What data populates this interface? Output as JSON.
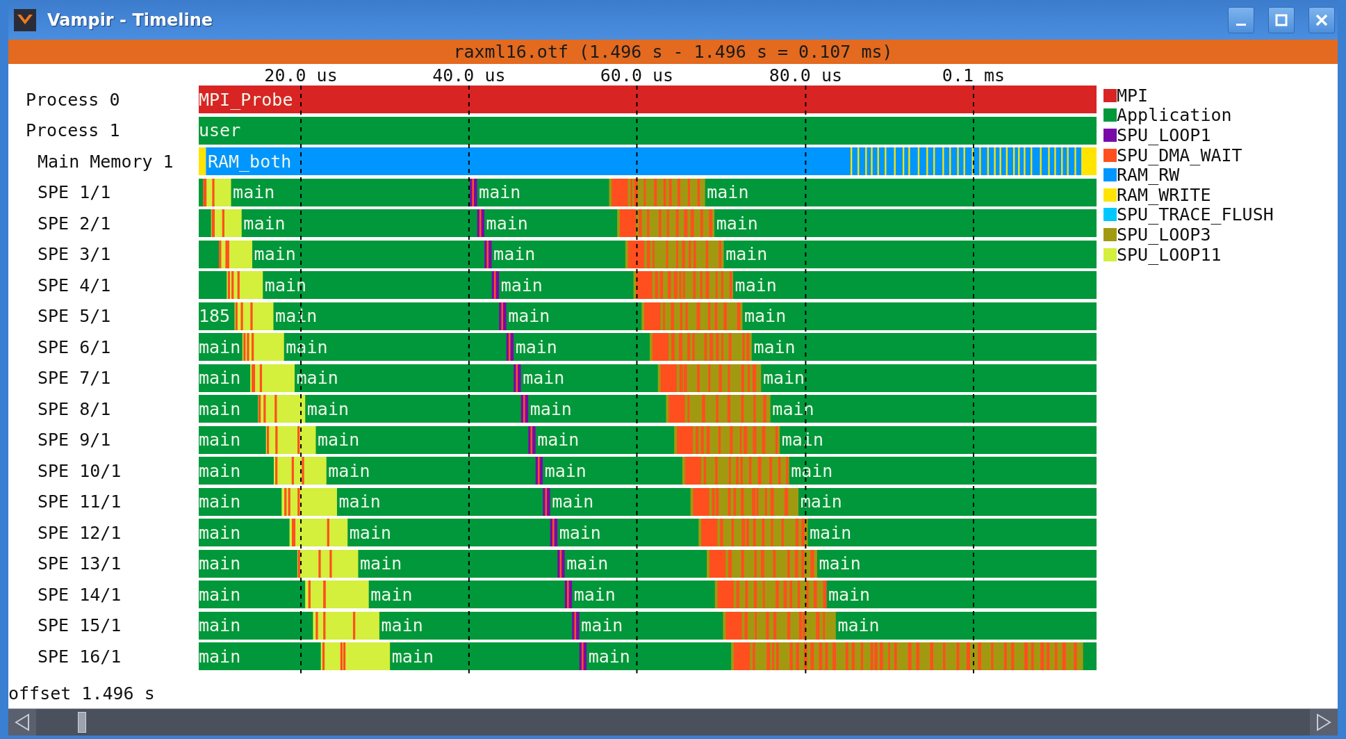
{
  "window": {
    "title": "Vampir - Timeline"
  },
  "header": "raxml16.otf (1.496 s - 1.496 s = 0.107 ms)",
  "axis": {
    "ticks": [
      "20.0 us",
      "40.0 us",
      "60.0 us",
      "80.0 us",
      "0.1 ms"
    ]
  },
  "rows": [
    {
      "label": "Process 0",
      "kind": "mpi",
      "segment_labels": [
        "MPI_Probe"
      ]
    },
    {
      "label": "Process 1",
      "kind": "application",
      "segment_labels": [
        "user"
      ]
    },
    {
      "label": "Main Memory 1",
      "kind": "memory",
      "segment_labels": [
        "RAM_both"
      ]
    },
    {
      "label": "SPE 1/1",
      "kind": "spe",
      "open_end": false,
      "segment_labels": [
        "main",
        "main",
        "main"
      ]
    },
    {
      "label": "SPE 2/1",
      "kind": "spe",
      "open_end": false,
      "segment_labels": [
        "main",
        "main",
        "main"
      ]
    },
    {
      "label": "SPE 3/1",
      "kind": "spe",
      "open_end": false,
      "segment_labels": [
        "main",
        "main",
        "main"
      ]
    },
    {
      "label": "SPE 4/1",
      "kind": "spe",
      "open_end": false,
      "segment_labels": [
        "main",
        "main",
        "main"
      ]
    },
    {
      "label": "SPE 5/1",
      "kind": "spe",
      "open_end": false,
      "segment_labels": [
        "185",
        "main",
        "main",
        "main"
      ]
    },
    {
      "label": "SPE 6/1",
      "kind": "spe",
      "open_end": false,
      "segment_labels": [
        "main",
        "main",
        "main",
        "main"
      ]
    },
    {
      "label": "SPE 7/1",
      "kind": "spe",
      "open_end": false,
      "segment_labels": [
        "main",
        "main",
        "main",
        "main"
      ]
    },
    {
      "label": "SPE 8/1",
      "kind": "spe",
      "open_end": false,
      "segment_labels": [
        "main",
        "main",
        "main",
        "main"
      ]
    },
    {
      "label": "SPE 9/1",
      "kind": "spe",
      "open_end": false,
      "segment_labels": [
        "main",
        "main",
        "main",
        "main"
      ]
    },
    {
      "label": "SPE 10/1",
      "kind": "spe",
      "open_end": false,
      "segment_labels": [
        "main",
        "main",
        "main",
        "main"
      ]
    },
    {
      "label": "SPE 11/1",
      "kind": "spe",
      "open_end": false,
      "segment_labels": [
        "main",
        "main",
        "main",
        "main"
      ]
    },
    {
      "label": "SPE 12/1",
      "kind": "spe",
      "open_end": false,
      "segment_labels": [
        "main",
        "main",
        "main",
        "main"
      ]
    },
    {
      "label": "SPE 13/1",
      "kind": "spe",
      "open_end": false,
      "segment_labels": [
        "main",
        "main",
        "main",
        "main"
      ]
    },
    {
      "label": "SPE 14/1",
      "kind": "spe",
      "open_end": false,
      "segment_labels": [
        "main",
        "main",
        "main",
        "main"
      ]
    },
    {
      "label": "SPE 15/1",
      "kind": "spe",
      "open_end": false,
      "segment_labels": [
        "main",
        "main",
        "main",
        "main"
      ]
    },
    {
      "label": "SPE 16/1",
      "kind": "spe",
      "open_end": true,
      "segment_labels": [
        "main",
        "main",
        "main"
      ]
    }
  ],
  "legend": [
    {
      "name": "MPI",
      "color": "#d92424"
    },
    {
      "name": "Application",
      "color": "#00983a"
    },
    {
      "name": "SPU_LOOP1",
      "color": "#7a0aa8"
    },
    {
      "name": "SPU_DMA_WAIT",
      "color": "#ff4f1f"
    },
    {
      "name": "RAM_RW",
      "color": "#0096ff"
    },
    {
      "name": "RAM_WRITE",
      "color": "#ffe400"
    },
    {
      "name": "SPU_TRACE_FLUSH",
      "color": "#00c8ff"
    },
    {
      "name": "SPU_LOOP3",
      "color": "#a19a10"
    },
    {
      "name": "SPU_LOOP11",
      "color": "#d4ef3c"
    }
  ],
  "offset": "offset 1.496 s"
}
